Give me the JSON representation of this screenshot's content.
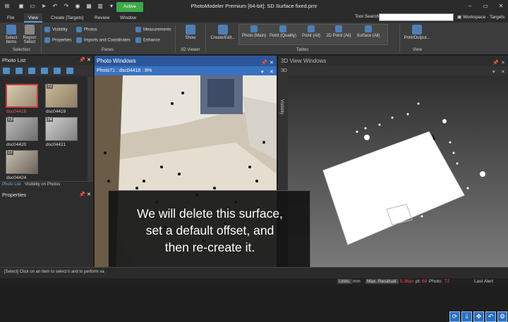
{
  "app": {
    "title": "PhotoModeler Premium [64-bit]: SD Surface fixed.pmr",
    "active_badge": "Active"
  },
  "menu": {
    "tabs": [
      "File",
      "View",
      "Create  [Targets]",
      "Review",
      "Window"
    ],
    "active_tab": "View",
    "tool_search_label": "Tool Search",
    "tool_search_value": "",
    "workspace": "Workspace - Targets"
  },
  "ribbon": {
    "select_items": "Select Items",
    "region_select": "Region Select",
    "selection_group": "Selection",
    "visibility": "Visibility",
    "properties": "Properties",
    "photos": "Photos",
    "imports": "Imports and Coordinates",
    "measurements": "Measurements",
    "enhance": "Enhance",
    "panes_group": "Panes",
    "show": "Show",
    "viewer_group": "3D Viewer",
    "create_edit": "Create/Edit...",
    "tables": [
      "Photo (Main)",
      "Point (Quality)",
      "Point (All)",
      "2D Point (All)",
      "Surface (All)"
    ],
    "tables_group": "Tables",
    "print_output": "Print/Output...",
    "view_group": "View"
  },
  "photo_list": {
    "title": "Photo List",
    "thumbs": [
      {
        "num": "",
        "label": "dsc04418",
        "selected": true
      },
      {
        "num": "72",
        "label": "dsc04419",
        "selected": false
      },
      {
        "num": "73",
        "label": "dsc04420",
        "selected": false
      },
      {
        "num": "74",
        "label": "dsc04421",
        "selected": false
      },
      {
        "num": "77",
        "label": "dsc04424",
        "selected": false
      }
    ],
    "subtabs": [
      "Photo List",
      "Visibility on Photos"
    ],
    "active_subtab": "Photo List"
  },
  "properties": {
    "title": "Properties"
  },
  "photo_window": {
    "title": "Photo Windows",
    "subtitle": "Photo71 : dsc04418 : 8%"
  },
  "view3d": {
    "title": "3D View Windows",
    "subtitle": "3D",
    "visibility_label": "Visibility"
  },
  "caption": {
    "lines": [
      "We will delete this surface,",
      "set a default offset, and",
      "then re-create it."
    ]
  },
  "status": {
    "message": "[Select] Click on an item to select it and to perform va",
    "units_label": "Units:",
    "units_value": "mm",
    "max_residual_label": "Max. Residual:",
    "max_residual_value": "5.36px",
    "pt_label": "pt:",
    "pt_value": "69",
    "photo_label": "Photo:",
    "photo_value": "72",
    "last_alert": "Last Alert"
  },
  "colors": {
    "accent": "#2b579a",
    "active_green": "#3fa84a",
    "error_red": "#ff4a4a"
  }
}
